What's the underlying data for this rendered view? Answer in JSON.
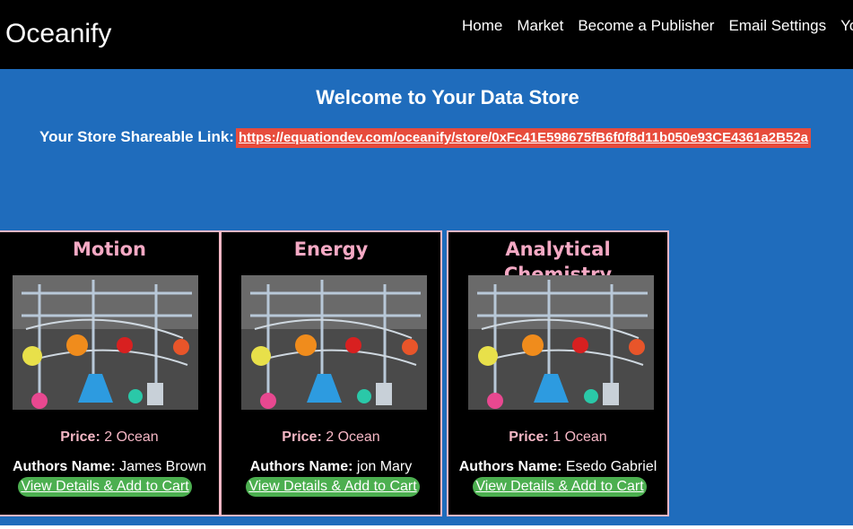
{
  "navbar": {
    "brand": "Oceanify",
    "links": [
      "Home",
      "Market",
      "Become a Publisher",
      "Email Settings",
      "Your"
    ]
  },
  "hero": {
    "title": "Welcome to Your Data Store",
    "share_label": "Your Store Shareable Link:",
    "share_url": "https://equationdev.com/oceanify/store/0xFc41E598675fB6f0f8d11b050e93CE4361a2B52a"
  },
  "cards": [
    {
      "title": "Motion",
      "price_label": "Price:",
      "price_value": "2 Ocean",
      "authors_label": "Authors Name:",
      "authors_value": "James Brown",
      "button_label": "View Details & Add to Cart"
    },
    {
      "title": "Energy",
      "price_label": "Price:",
      "price_value": "2 Ocean",
      "authors_label": "Authors Name:",
      "authors_value": "jon Mary",
      "button_label": "View Details & Add to Cart"
    },
    {
      "title": "Analytical Chemistry",
      "price_label": "Price:",
      "price_value": "1 Ocean",
      "authors_label": "Authors Name:",
      "authors_value": "Esedo Gabriel",
      "button_label": "View Details & Add to Cart"
    }
  ],
  "colors": {
    "navbar_bg": "#000000",
    "hero_bg": "#1f6cbc",
    "link_highlight": "#e74c3c",
    "card_border": "#f5b7c5",
    "card_title": "#f5a9c4",
    "button_bg": "#4caf50"
  }
}
